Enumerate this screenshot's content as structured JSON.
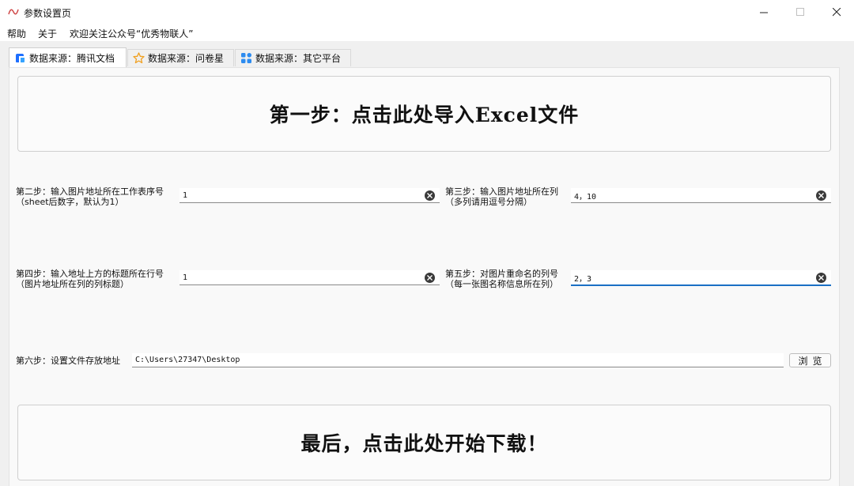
{
  "window": {
    "title": "参数设置页",
    "controls": {
      "minimize": "—",
      "maximize": "☐",
      "close": "✕"
    }
  },
  "menu": {
    "items": [
      "帮助",
      "关于",
      "欢迎关注公众号“优秀物联人”"
    ]
  },
  "tabs": [
    {
      "label": "数据来源：腾讯文档",
      "icon": "tencent-docs-icon",
      "active": true
    },
    {
      "label": "数据来源：问卷星",
      "icon": "star-icon",
      "active": false
    },
    {
      "label": "数据来源：其它平台",
      "icon": "grid-icon",
      "active": false
    }
  ],
  "step1": {
    "label": "第一步：点击此处导入Excel文件"
  },
  "step2": {
    "label_line1": "第二步：输入图片地址所在工作表序号",
    "label_line2": "（sheet后数字，默认为1）",
    "value": "1"
  },
  "step3": {
    "label_line1": "第三步：输入图片地址所在列",
    "label_line2": "（多列请用逗号分隔）",
    "value": "4，10"
  },
  "step4": {
    "label_line1": "第四步：输入地址上方的标题所在行号",
    "label_line2": "（图片地址所在列的列标题）",
    "value": "1"
  },
  "step5": {
    "label_line1": "第五步：对图片重命名的列号",
    "label_line2": "（每一张图名称信息所在列）",
    "value": "2，3"
  },
  "step6": {
    "label": "第六步：设置文件存放地址",
    "value": "C:\\Users\\27347\\Desktop",
    "browse_label": "浏览"
  },
  "final": {
    "label": "最后，点击此处开始下载！"
  },
  "colors": {
    "accent": "#1a6fc4",
    "tencent_blue": "#1e6fff",
    "star_orange": "#f0a020",
    "grid_blue": "#2d8cf0"
  }
}
